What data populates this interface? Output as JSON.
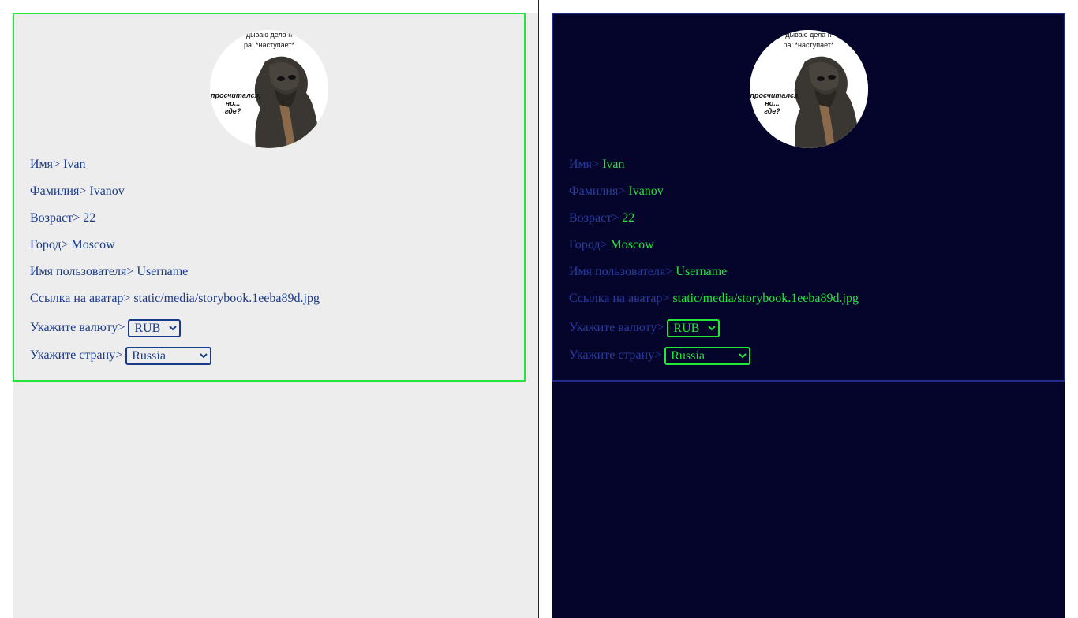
{
  "avatar": {
    "caption_top_1": "дываю дела н",
    "caption_top_2": "ра: *наступает*",
    "caption_left_1": "просчитался,",
    "caption_left_2": "но...",
    "caption_left_3": "где?"
  },
  "profile": {
    "first_name_label": "Имя>",
    "first_name": "Ivan",
    "last_name_label": "Фамилия>",
    "last_name": "Ivanov",
    "age_label": "Возраст>",
    "age": "22",
    "city_label": "Город>",
    "city": "Moscow",
    "username_label": "Имя пользователя>",
    "username": "Username",
    "avatar_link_label": "Ссылка на аватар>",
    "avatar_link": "static/media/storybook.1eeba89d.jpg",
    "currency_label": "Укажите валюту>",
    "currency": "RUB",
    "country_label": "Укажите страну>",
    "country": "Russia"
  },
  "colors": {
    "light_bg": "#ededed",
    "light_border": "#22e63a",
    "light_text": "#1a3b8a",
    "dark_bg": "#05052b",
    "dark_border": "#1f2e8c",
    "dark_label": "#2a3b9e",
    "dark_value": "#22e63a"
  }
}
